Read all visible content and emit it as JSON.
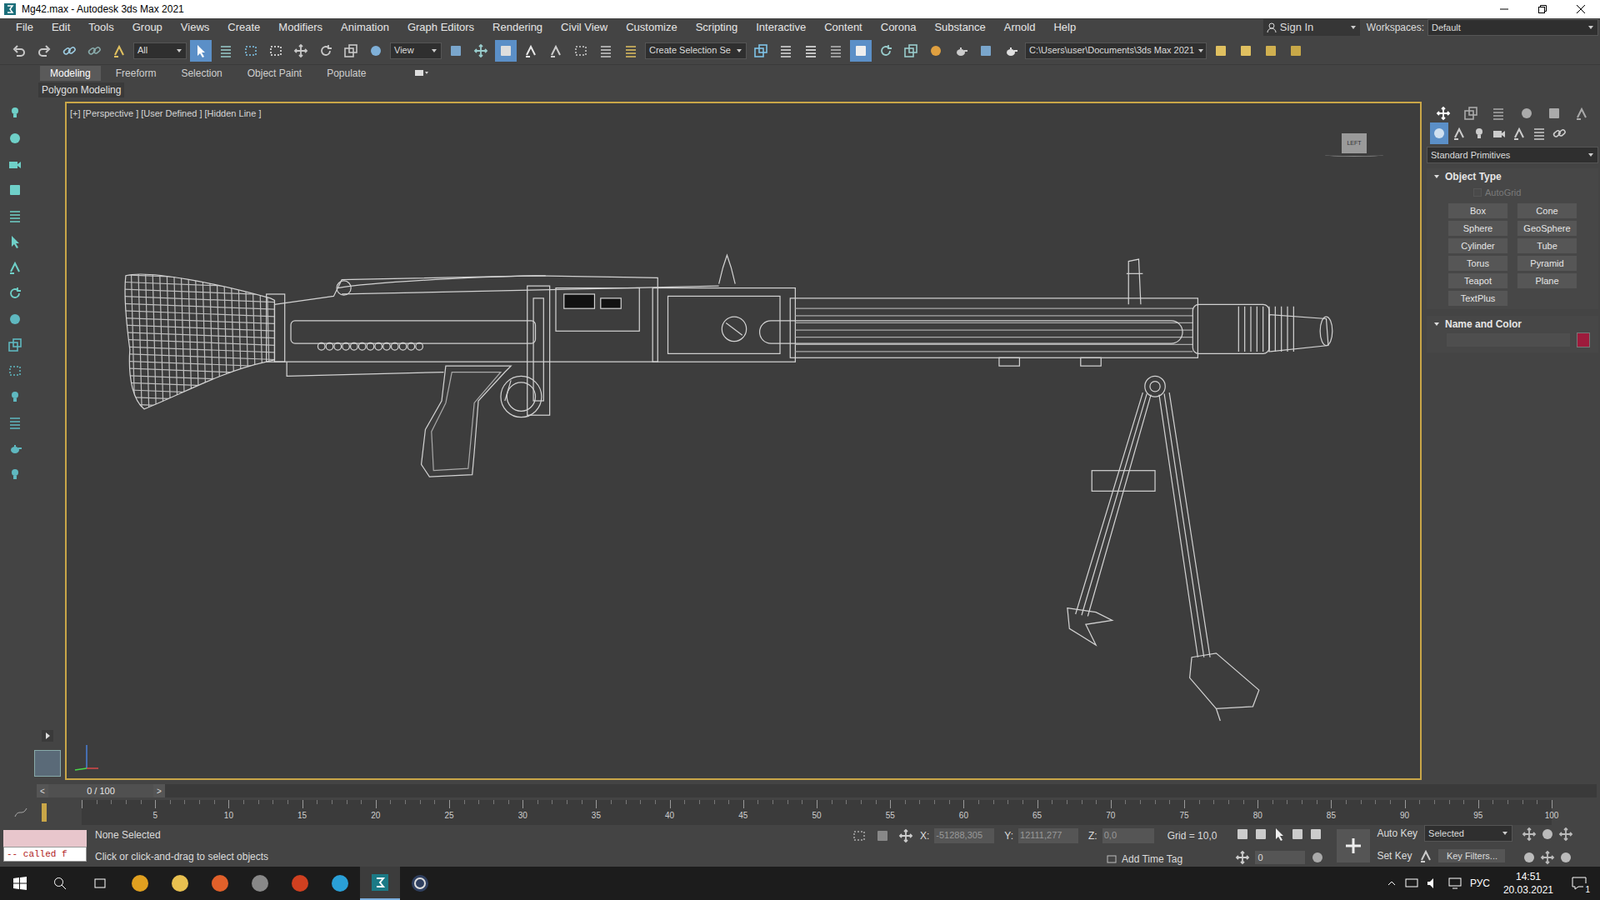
{
  "window": {
    "title": "Mg42.max - Autodesk 3ds Max 2021"
  },
  "menu": [
    "File",
    "Edit",
    "Tools",
    "Group",
    "Views",
    "Create",
    "Modifiers",
    "Animation",
    "Graph Editors",
    "Rendering",
    "Civil View",
    "Customize",
    "Scripting",
    "Interactive",
    "Content",
    "Corona",
    "Substance",
    "Arnold",
    "Help"
  ],
  "account": {
    "sign_in": "Sign In",
    "workspaces_label": "Workspaces:",
    "workspace": "Default"
  },
  "toolbar": {
    "filter": "All",
    "coord_system": "View",
    "selection_set": "Create Selection Se",
    "project_path": "C:\\Users\\user\\Documents\\3ds Max 2021",
    "select_object_active": true,
    "keyboard_override_active": true,
    "ribbon_active": true
  },
  "ribbon_tabs": [
    {
      "label": "Modeling",
      "selected": true
    },
    {
      "label": "Freeform",
      "selected": false
    },
    {
      "label": "Selection",
      "selected": false
    },
    {
      "label": "Object Paint",
      "selected": false
    },
    {
      "label": "Populate",
      "selected": false
    }
  ],
  "ribbon_panel": "Polygon Modeling",
  "viewport": {
    "labels": [
      "[+]",
      "[Perspective ]",
      "[User Defined ]",
      "[Hidden Line ]"
    ],
    "viewcube": "LEFT",
    "active": true
  },
  "command_panel": {
    "category": "Standard Primitives",
    "object_type": {
      "title": "Object Type",
      "autogrid": {
        "label": "AutoGrid",
        "checked": false,
        "disabled": true
      },
      "buttons": [
        "Box",
        "Cone",
        "Sphere",
        "GeoSphere",
        "Cylinder",
        "Tube",
        "Torus",
        "Pyramid",
        "Teapot",
        "Plane",
        "TextPlus"
      ]
    },
    "name_and_color": {
      "title": "Name and Color",
      "name": "",
      "color": "#9e1b3c"
    }
  },
  "time_slider": {
    "label": "0 / 100",
    "level": 0,
    "prev": "<",
    "next": ">"
  },
  "track_bar": {
    "ticks": [
      "5",
      "10",
      "15",
      "20",
      "25",
      "30",
      "35",
      "40",
      "45",
      "50",
      "55",
      "60",
      "65",
      "70",
      "75",
      "80",
      "85",
      "90",
      "95",
      "100"
    ]
  },
  "status": {
    "listener": "-- called f",
    "selection": "None Selected",
    "prompt": "Click or click-and-drag to select objects",
    "x_label": "X:",
    "x": "-51288,305",
    "y_label": "Y:",
    "y": "12111,277",
    "z_label": "Z:",
    "z": "0,0",
    "grid": "Grid = 10,0",
    "add_time_tag": "Add Time Tag",
    "auto_key": "Auto Key",
    "set_key": "Set Key",
    "key_mode": "Selected",
    "key_filters": "Key Filters...",
    "frame": "0"
  },
  "taskbar": {
    "language": "РУС",
    "time": "14:51",
    "date": "20.03.2021",
    "notification_count": "1",
    "max_app_active": true
  }
}
